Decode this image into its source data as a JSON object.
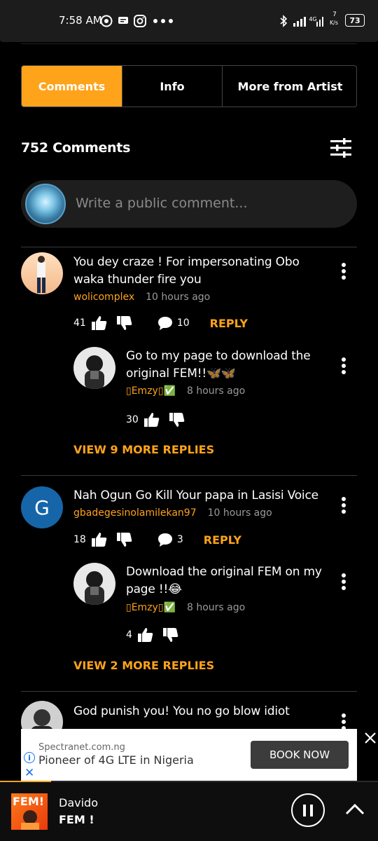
{
  "status_bar": {
    "time": "7:58 AM",
    "network": "4G",
    "speed_top": "7",
    "speed_bottom": "K/s",
    "battery": "73"
  },
  "tabs": [
    {
      "label": "Comments",
      "active": true
    },
    {
      "label": "Info",
      "active": false
    },
    {
      "label": "More from Artist",
      "active": false
    }
  ],
  "comments_count": "752 Comments",
  "compose": {
    "placeholder": "Write a public comment..."
  },
  "comments": [
    {
      "text_line1": "You dey craze ! For impersonating Obo",
      "text_line2": "waka thunder fire you",
      "user": "wolicomplex",
      "time": "10 hours ago",
      "likes": "41",
      "replies": "10",
      "reply_label": "REPLY",
      "reply": {
        "text_line1": "Go to my page to download the",
        "text_line2": "original FEM!!🦋🦋",
        "user": "▯Emzy▯✅",
        "time": "8 hours ago",
        "likes": "30"
      },
      "more_replies": "VIEW 9 MORE REPLIES"
    },
    {
      "avatar_letter": "G",
      "text_line1": "Nah Ogun Go Kill Your papa in Lasisi Voice",
      "user": "gbadegesinolamilekan97",
      "time": "10 hours ago",
      "likes": "18",
      "replies": "3",
      "reply_label": "REPLY",
      "reply": {
        "text_line1": "Download the original FEM on my",
        "text_line2": "page !!😂",
        "user": "▯Emzy▯✅",
        "time": "8 hours ago",
        "likes": "4"
      },
      "more_replies": "VIEW 2 MORE REPLIES"
    },
    {
      "text_line1": "God punish you! You no go blow idiot"
    }
  ],
  "ad": {
    "source": "Spectranet.com.ng",
    "headline": "Pioneer of 4G LTE in Nigeria",
    "button": "BOOK NOW"
  },
  "player": {
    "artist": "Davido",
    "song": "FEM !",
    "art_text": "FEM!",
    "progress": 0.135
  },
  "colors": {
    "accent": "#ffa31a",
    "background": "#000000",
    "compose_bg": "#1e1e1e",
    "g_avatar": "#1565a8"
  }
}
